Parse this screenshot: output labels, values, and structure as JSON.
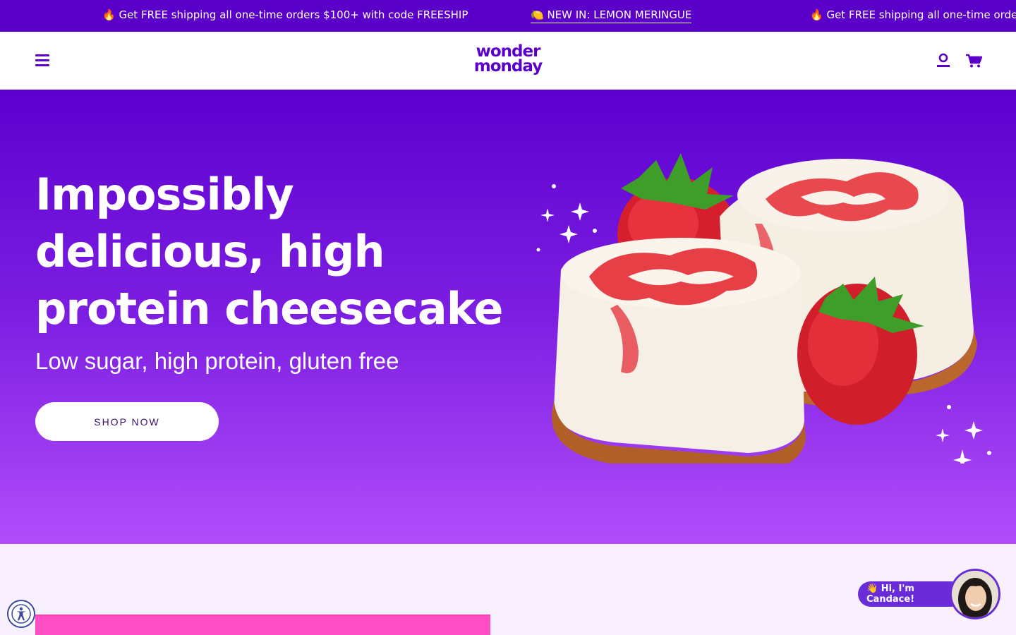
{
  "announcement": {
    "shipping_text": "🔥 Get FREE shipping all one-time orders $100+ with code FREESHIP",
    "new_text": "🍋 NEW IN: LEMON MERINGUE",
    "shipping_text_repeat": "🔥 Get FREE shipping all one-time orde"
  },
  "header": {
    "logo_line1": "wonder",
    "logo_line2": "monday"
  },
  "hero": {
    "title": "Impossibly delicious, high protein cheesecake",
    "subtitle": "Low sugar, high protein, gluten free",
    "cta_label": "SHOP NOW"
  },
  "chat": {
    "greeting": "👋 Hi, I'm Candace!"
  },
  "colors": {
    "brand_purple": "#5b00c8",
    "hero_gradient_top": "#5c00cf",
    "hero_gradient_bottom": "#b24dfb",
    "accent_pink": "#ff4dc4"
  }
}
